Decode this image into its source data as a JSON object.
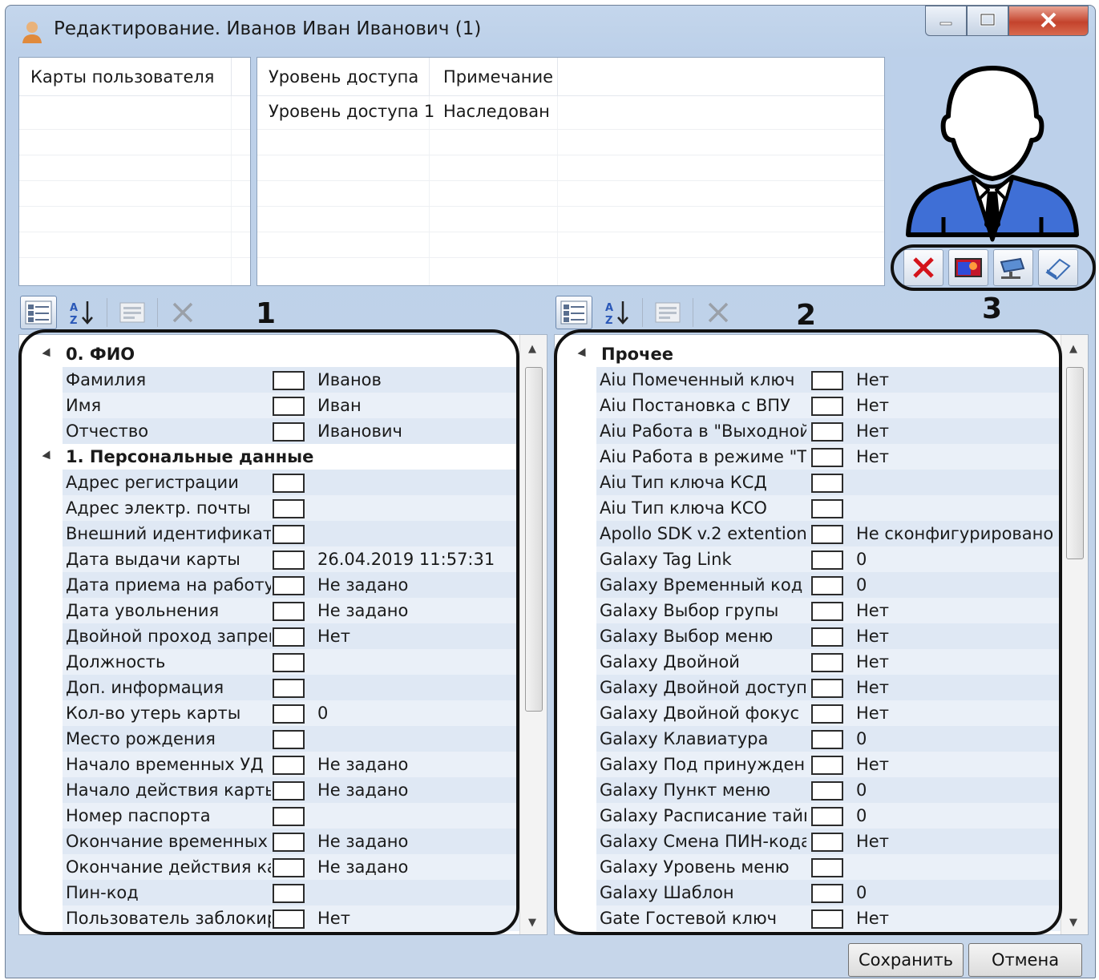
{
  "window": {
    "title": "Редактирование. Иванов Иван Иванович (1)",
    "controls": {
      "minimize": "minimize-icon",
      "maximize": "maximize-icon",
      "close": "close-icon"
    }
  },
  "cards_panel": {
    "header": "Карты пользователя",
    "rows": []
  },
  "access_panel": {
    "headers": [
      "Уровень доступа",
      "Примечание"
    ],
    "rows": [
      {
        "level": "Уровень доступа 1",
        "note": "Наследован"
      }
    ]
  },
  "photo": {
    "tools": [
      "delete-photo-icon",
      "load-photo-icon",
      "camera-photo-icon",
      "scanner-icon"
    ],
    "annotation": "3"
  },
  "toolbar_icons": [
    "categorized-icon",
    "sort-alphabetical-icon",
    "property-pages-icon",
    "clear-icon"
  ],
  "left_grid": {
    "annotation": "1",
    "categories": [
      {
        "name": "0. ФИО",
        "items": [
          {
            "label": "Фамилия",
            "value": "Иванов"
          },
          {
            "label": "Имя",
            "value": "Иван"
          },
          {
            "label": "Отчество",
            "value": "Иванович"
          }
        ]
      },
      {
        "name": "1. Персональные данные",
        "items": [
          {
            "label": "Адрес регистрации",
            "value": ""
          },
          {
            "label": "Адрес электр. почты",
            "value": ""
          },
          {
            "label": "Внешний идентификатор",
            "value": ""
          },
          {
            "label": "Дата выдачи карты",
            "value": "26.04.2019 11:57:31"
          },
          {
            "label": "Дата приема на работу",
            "value": "Не задано"
          },
          {
            "label": "Дата увольнения",
            "value": "Не задано"
          },
          {
            "label": "Двойной проход запрещен",
            "value": "Нет"
          },
          {
            "label": "Должность",
            "value": ""
          },
          {
            "label": "Доп. информация",
            "value": ""
          },
          {
            "label": "Кол-во утерь карты",
            "value": "0"
          },
          {
            "label": "Место рождения",
            "value": ""
          },
          {
            "label": "Начало временных УД",
            "value": "Не задано"
          },
          {
            "label": "Начало действия карты",
            "value": "Не задано"
          },
          {
            "label": "Номер паспорта",
            "value": ""
          },
          {
            "label": "Окончание временных УД",
            "value": "Не задано"
          },
          {
            "label": "Окончание действия карты",
            "value": "Не задано"
          },
          {
            "label": "Пин-код",
            "value": ""
          },
          {
            "label": "Пользователь заблокирован",
            "value": "Нет"
          }
        ]
      }
    ]
  },
  "right_grid": {
    "annotation": "2",
    "categories": [
      {
        "name": "Прочее",
        "items": [
          {
            "label": "Aiu Помеченный ключ",
            "value": "Нет"
          },
          {
            "label": "Aiu Постановка с ВПУ",
            "value": "Нет"
          },
          {
            "label": "Aiu Работа в \"Выходной день\"",
            "value": "Нет"
          },
          {
            "label": "Aiu Работа в режиме \"Тревога\"",
            "value": "Нет"
          },
          {
            "label": "Aiu Тип ключа КСД",
            "value": ""
          },
          {
            "label": "Aiu Тип ключа КСО",
            "value": ""
          },
          {
            "label": "Apollo SDK v.2 extention",
            "value": "Не сконфигурировано"
          },
          {
            "label": "Galaxy Tag Link",
            "value": "0"
          },
          {
            "label": "Galaxy Временный код",
            "value": "0"
          },
          {
            "label": "Galaxy Выбор групы",
            "value": "Нет"
          },
          {
            "label": "Galaxy Выбор меню",
            "value": "Нет"
          },
          {
            "label": "Galaxy Двойной",
            "value": "Нет"
          },
          {
            "label": "Galaxy Двойной доступ",
            "value": "Нет"
          },
          {
            "label": "Galaxy Двойной фокус",
            "value": "Нет"
          },
          {
            "label": "Galaxy Клавиатура",
            "value": "0"
          },
          {
            "label": "Galaxy Под принуждением",
            "value": "Нет"
          },
          {
            "label": "Galaxy Пункт меню",
            "value": "0"
          },
          {
            "label": "Galaxy Расписание таймера",
            "value": "0"
          },
          {
            "label": "Galaxy Смена ПИН-кода",
            "value": "Нет"
          },
          {
            "label": "Galaxy Уровень меню",
            "value": ""
          },
          {
            "label": "Galaxy Шаблон",
            "value": "0"
          },
          {
            "label": "Gate Гостевой ключ",
            "value": "Нет"
          }
        ]
      }
    ]
  },
  "buttons": {
    "save": "Сохранить",
    "cancel": "Отмена"
  }
}
